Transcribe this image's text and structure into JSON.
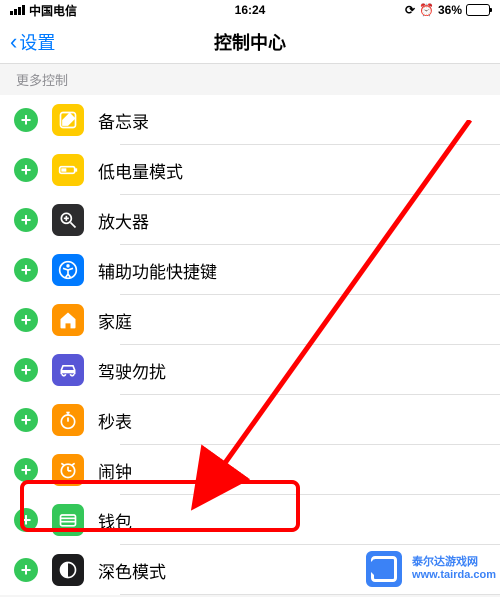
{
  "status": {
    "carrier": "中国电信",
    "time": "16:24",
    "battery_pct": "36%"
  },
  "nav": {
    "back_label": "设置",
    "title": "控制中心"
  },
  "section_header": "更多控制",
  "rows": [
    {
      "label": "备忘录",
      "icon": "notes-icon",
      "color_class": "ic-notes"
    },
    {
      "label": "低电量模式",
      "icon": "low-power-icon",
      "color_class": "ic-lowpower"
    },
    {
      "label": "放大器",
      "icon": "magnifier-icon",
      "color_class": "ic-magnifier"
    },
    {
      "label": "辅助功能快捷键",
      "icon": "accessibility-icon",
      "color_class": "ic-accessibility"
    },
    {
      "label": "家庭",
      "icon": "home-icon",
      "color_class": "ic-home"
    },
    {
      "label": "驾驶勿扰",
      "icon": "driving-dnd-icon",
      "color_class": "ic-dnd"
    },
    {
      "label": "秒表",
      "icon": "stopwatch-icon",
      "color_class": "ic-stopwatch"
    },
    {
      "label": "闹钟",
      "icon": "alarm-icon",
      "color_class": "ic-alarm"
    },
    {
      "label": "钱包",
      "icon": "wallet-icon",
      "color_class": "ic-wallet"
    },
    {
      "label": "深色模式",
      "icon": "dark-mode-icon",
      "color_class": "ic-dark"
    }
  ],
  "annotation": {
    "highlighted_row_label": "钱包"
  },
  "watermark": {
    "line1": "泰尔达游戏网",
    "line2": "www.tairda.com"
  }
}
